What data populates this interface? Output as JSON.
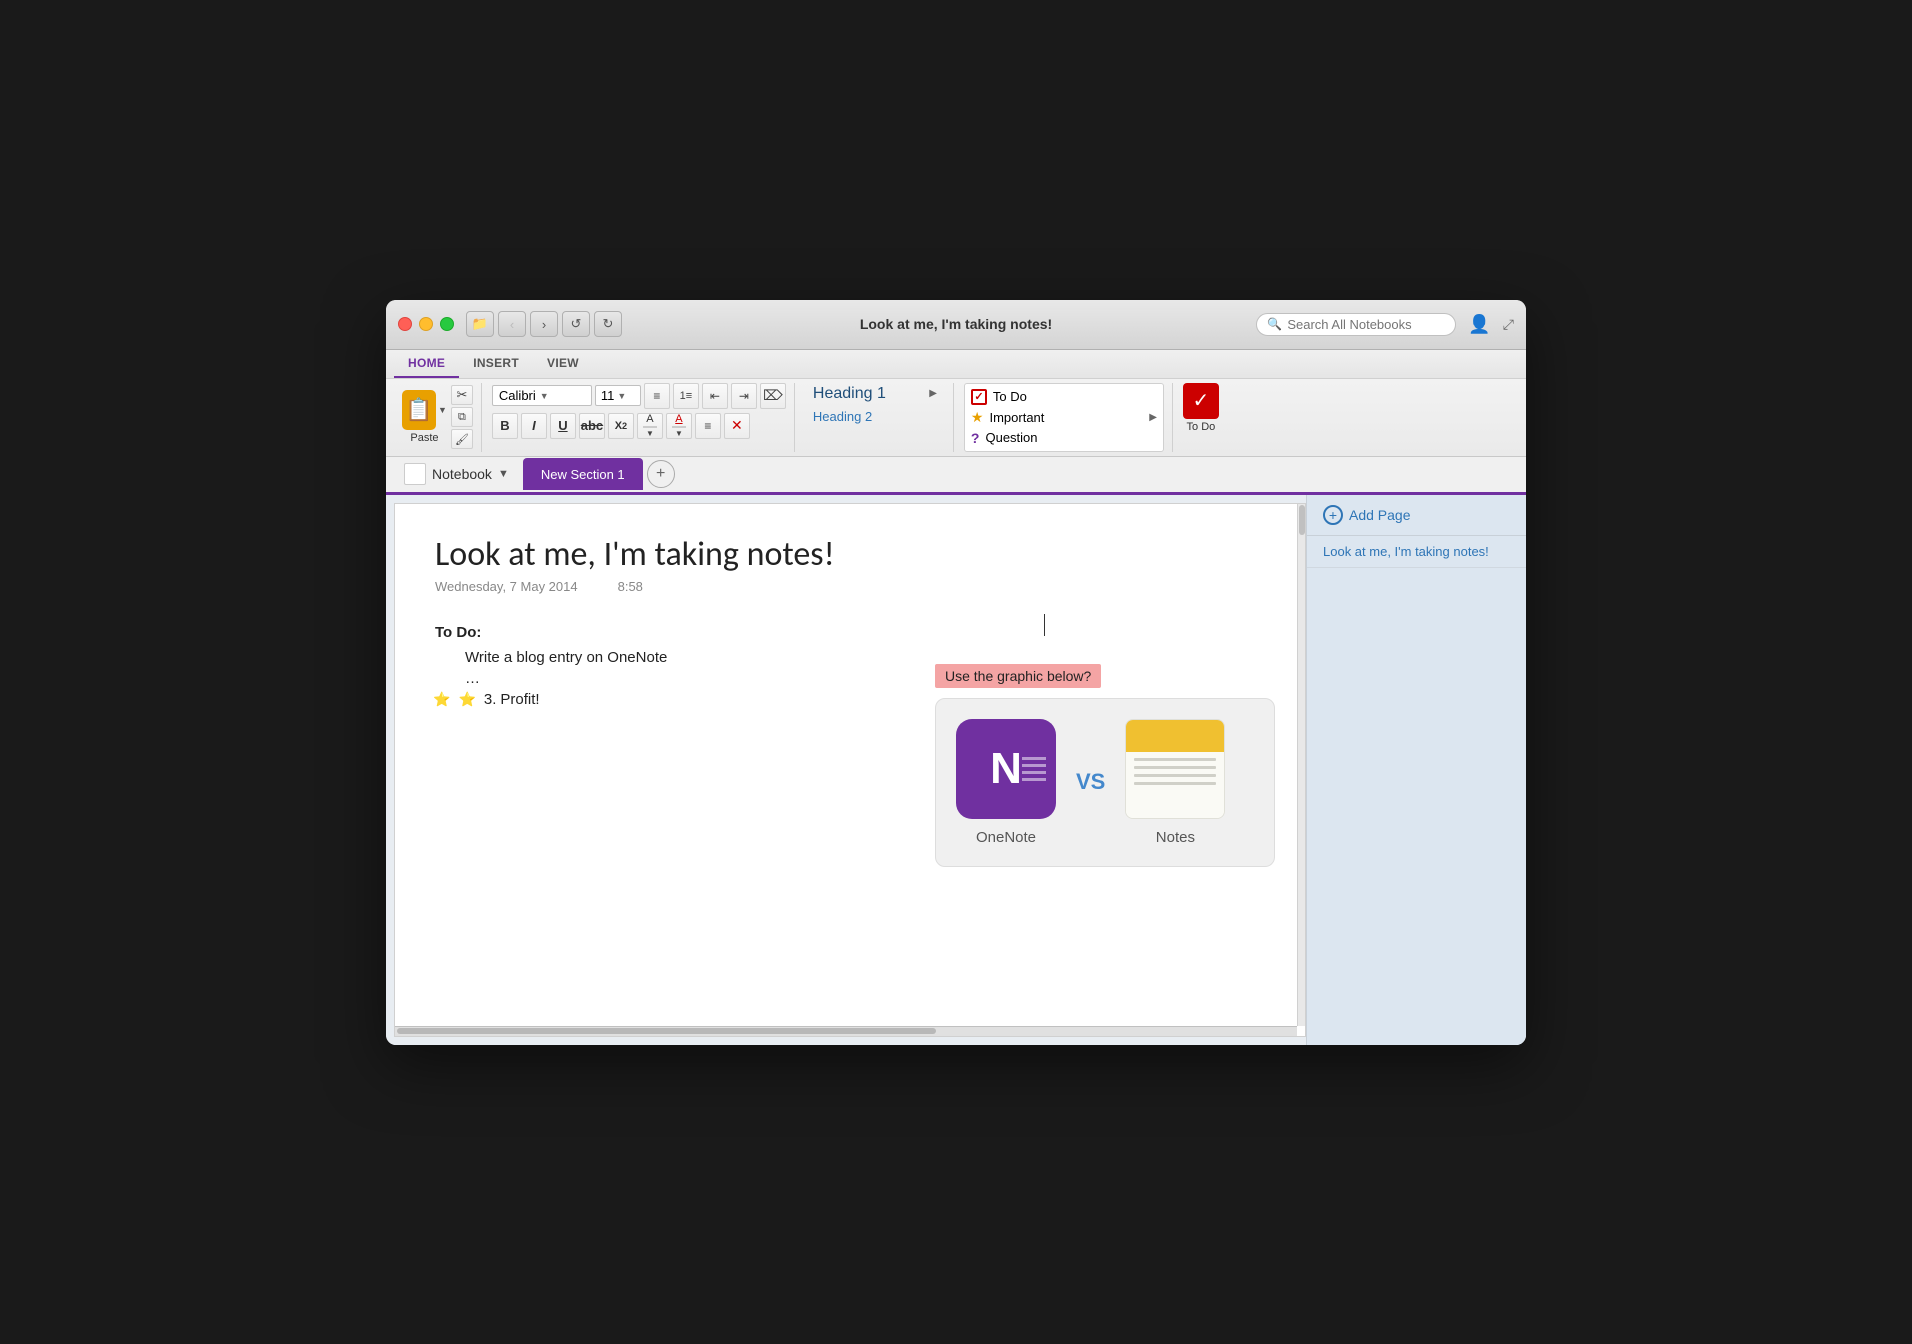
{
  "window": {
    "title": "Look at me, I'm taking notes!"
  },
  "titlebar": {
    "title": "Look at me, I'm taking notes!",
    "search_placeholder": "Search All Notebooks",
    "nav": {
      "back": "‹",
      "forward": "›",
      "undo": "↩",
      "redo": "↪"
    }
  },
  "ribbon": {
    "tabs": [
      "HOME",
      "INSERT",
      "VIEW"
    ],
    "active_tab": "HOME",
    "paste_label": "Paste",
    "font": {
      "name": "Calibri",
      "size": "11"
    },
    "format_btns": {
      "bold": "B",
      "italic": "I",
      "underline": "U",
      "strikethrough": "abc",
      "subscript": "X₂"
    },
    "headings": {
      "heading1": "Heading 1",
      "heading2": "Heading 2"
    },
    "tags": {
      "todo": "To Do",
      "important": "Important",
      "question": "Question"
    },
    "todo_label": "To Do"
  },
  "notebook": {
    "name": "Notebook",
    "section": "New Section 1",
    "add_section_title": "+"
  },
  "page": {
    "title": "Look at me, I'm taking notes!",
    "date": "Wednesday, 7 May 2014",
    "time": "8:58",
    "content": {
      "todo_heading": "To Do:",
      "todo_items": [
        "Write a blog entry on OneNote",
        "…",
        "Profit!"
      ],
      "highlight_note": "Use the graphic below?",
      "app1_label": "OneNote",
      "app2_label": "Notes",
      "vs_text": "VS"
    }
  },
  "sidebar": {
    "add_page_label": "Add Page",
    "pages": [
      "Look at me, I'm taking notes!"
    ]
  }
}
